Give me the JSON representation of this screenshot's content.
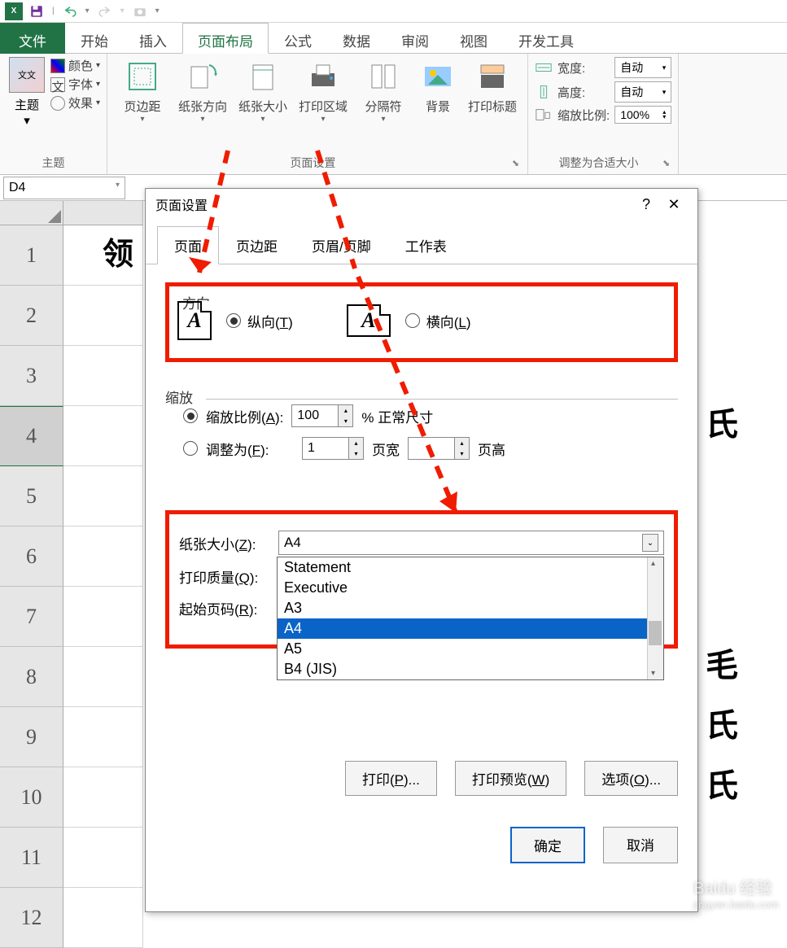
{
  "qat": {
    "app": "X"
  },
  "tabs": {
    "file": "文件",
    "items": [
      "开始",
      "插入",
      "页面布局",
      "公式",
      "数据",
      "审阅",
      "视图",
      "开发工具"
    ],
    "active": "页面布局"
  },
  "ribbon": {
    "theme": {
      "label": "主题",
      "themes": "主题",
      "colors": "颜色",
      "fonts": "字体",
      "effects": "效果"
    },
    "pagesetup": {
      "label": "页面设置",
      "margins": "页边距",
      "orientation": "纸张方向",
      "size": "纸张大小",
      "printarea": "打印区域",
      "breaks": "分隔符",
      "background": "背景",
      "titles": "打印标题"
    },
    "scale": {
      "label": "调整为合适大小",
      "width": "宽度:",
      "height": "高度:",
      "scale": "缩放比例:",
      "auto": "自动",
      "scaleval": "100%"
    }
  },
  "namebox": "D4",
  "grid": {
    "rows": [
      "1",
      "2",
      "3",
      "4",
      "5",
      "6",
      "7",
      "8",
      "9",
      "10",
      "11",
      "12"
    ],
    "cell_a1": "领",
    "bg_r4": "氏",
    "bg_r8": "毛",
    "bg_r9": "氏",
    "bg_r10": "氏"
  },
  "dialog": {
    "title": "页面设置",
    "tabs": {
      "page": "页面",
      "margins": "页边距",
      "headerfooter": "页眉/页脚",
      "sheet": "工作表"
    },
    "orientation": {
      "label": "方向",
      "portrait": "纵向(T)",
      "landscape": "横向(L)",
      "selected": "portrait"
    },
    "zoom": {
      "label": "缩放",
      "adjust_label": "缩放比例(A):",
      "adjust_value": "100",
      "adjust_suffix": "% 正常尺寸",
      "fit_label": "调整为(F):",
      "fit_wide": "1",
      "fit_wide_suffix": "页宽",
      "fit_tall": "",
      "fit_tall_suffix": "页高"
    },
    "paper": {
      "size_label": "纸张大小(Z):",
      "size_value": "A4",
      "quality_label": "打印质量(Q):",
      "first_label": "起始页码(R):",
      "options": [
        "Statement",
        "Executive",
        "A3",
        "A4",
        "A5",
        "B4 (JIS)"
      ],
      "selected": "A4"
    },
    "buttons": {
      "print": "打印(P)...",
      "preview": "打印预览(W)",
      "options": "选项(O)...",
      "ok": "确定",
      "cancel": "取消"
    }
  },
  "watermark": {
    "main": "Baidu 经验",
    "sub": "jingyan.baidu.com"
  }
}
